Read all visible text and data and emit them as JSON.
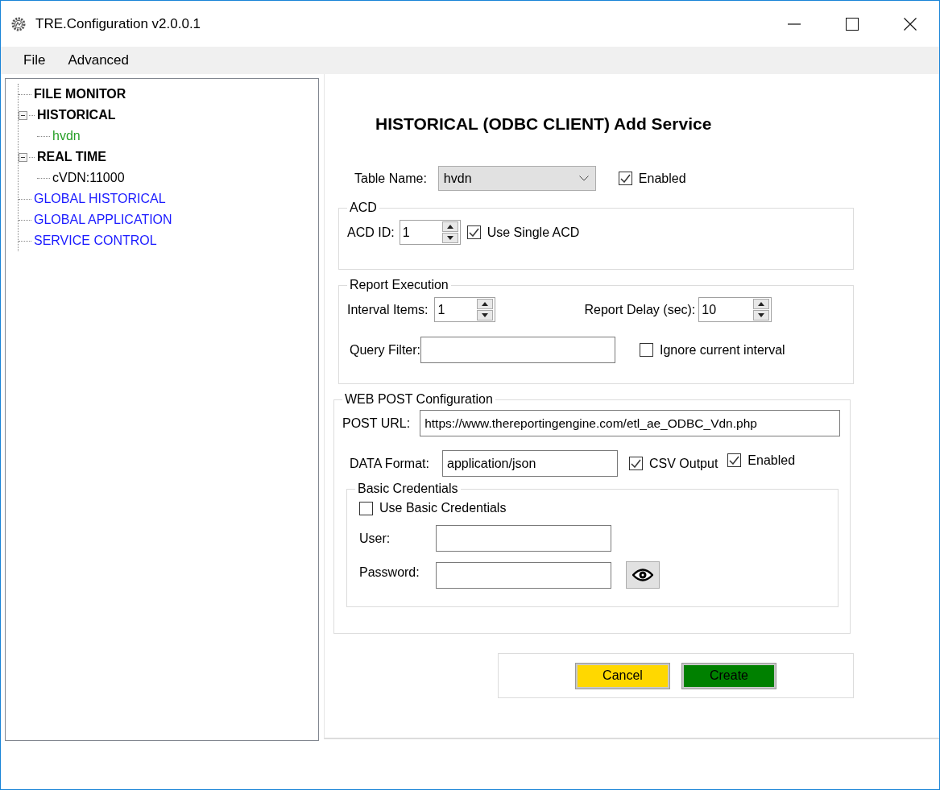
{
  "window": {
    "title": "TRE.Configuration v2.0.0.1"
  },
  "menu": [
    {
      "label": "File"
    },
    {
      "label": "Advanced"
    }
  ],
  "tree": [
    {
      "label": "FILE MONITOR",
      "kind": "section",
      "color": "#000000"
    },
    {
      "label": "HISTORICAL",
      "kind": "section",
      "color": "#000000",
      "expanded": true,
      "children": [
        {
          "label": "hvdn",
          "kind": "leaf",
          "color": "#28a028"
        }
      ]
    },
    {
      "label": "REAL TIME",
      "kind": "section",
      "color": "#000000",
      "expanded": true,
      "children": [
        {
          "label": "cVDN:11000",
          "kind": "leaf",
          "color": "#000000"
        }
      ]
    },
    {
      "label": "GLOBAL HISTORICAL",
      "kind": "leaf",
      "color": "#1a1aff"
    },
    {
      "label": "GLOBAL APPLICATION",
      "kind": "leaf",
      "color": "#1a1aff"
    },
    {
      "label": "SERVICE CONTROL",
      "kind": "leaf",
      "color": "#1a1aff"
    }
  ],
  "form": {
    "title": "HISTORICAL (ODBC CLIENT) Add Service",
    "table_name": {
      "label": "Table Name:",
      "value": "hvdn"
    },
    "enabled": {
      "label": "Enabled",
      "checked": true
    },
    "acd": {
      "legend": "ACD",
      "acd_id": {
        "label": "ACD ID:",
        "value": "1"
      },
      "use_single": {
        "label": "Use Single ACD",
        "checked": true
      }
    },
    "report_execution": {
      "legend": "Report Execution",
      "interval_items": {
        "label": "Interval Items:",
        "value": "1"
      },
      "report_delay": {
        "label": "Report Delay (sec):",
        "value": "10"
      },
      "query_filter": {
        "label": "Query Filter:"
      },
      "ignore_current": {
        "label": "Ignore current interval",
        "checked": false
      }
    },
    "web_post": {
      "legend": "WEB POST Configuration",
      "post_url": {
        "label": "POST URL:",
        "value": "https://www.thereportingengine.com/etl_ae_ODBC_Vdn.php"
      },
      "data_format": {
        "label": "DATA Format:",
        "value": "application/json"
      },
      "csv_output": {
        "label": "CSV Output",
        "checked": true
      },
      "enabled": {
        "label": "Enabled",
        "checked": true
      },
      "basic_credentials": {
        "legend": "Basic Credentials",
        "use_basic": {
          "label": "Use Basic Credentials",
          "checked": false
        },
        "user": {
          "label": "User:"
        },
        "password": {
          "label": "Password:"
        }
      }
    },
    "buttons": [
      {
        "label": "Cancel",
        "color": "#ffd800"
      },
      {
        "label": "Create",
        "color": "#008000"
      }
    ]
  }
}
